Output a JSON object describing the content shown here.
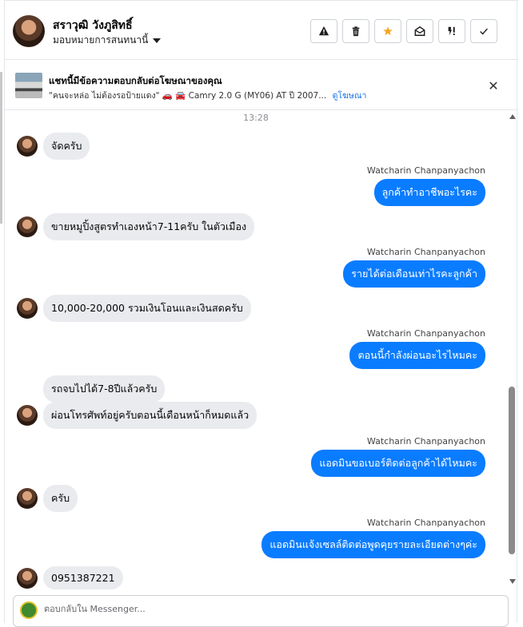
{
  "header": {
    "contact_name": "สราวุฒิ วังภูสิทธิ์",
    "assign_label": "มอบหมายการสนทนานี้",
    "actions": [
      {
        "name": "mark-spam-button",
        "icon": "warning-icon"
      },
      {
        "name": "delete-button",
        "icon": "trash-icon"
      },
      {
        "name": "star-button",
        "icon": "star-icon"
      },
      {
        "name": "mark-unread-button",
        "icon": "envelope-open-icon"
      },
      {
        "name": "follow-up-button",
        "icon": "priority-icon"
      },
      {
        "name": "mark-done-button",
        "icon": "check-icon"
      }
    ]
  },
  "ad": {
    "title": "แชทนี้มีข้อความตอบกลับต่อโฆษณาของคุณ",
    "subtitle": "\"คนจะหล่อ ไม่ต้องรอป้ายแดง\" 🚗 🚘 Camry 2.0 G (MY06) AT ปี 2007...",
    "link": "ดูโฆษณา"
  },
  "conversation": {
    "timestamp": "13:28",
    "messages": [
      {
        "dir": "in",
        "text": "จัดครับ"
      },
      {
        "dir": "out",
        "sender": "Watcharin Chanpanyachon",
        "text": "ลูกค้าทำอาชีพอะไรคะ"
      },
      {
        "dir": "in",
        "text": "ขายหมูปิ้งสูตรทำเองหน้า7-11ครับ ในตัวเมือง"
      },
      {
        "dir": "out",
        "sender": "Watcharin Chanpanyachon",
        "text": "รายได้ต่อเดือนเท่าไรคะลูกค้า"
      },
      {
        "dir": "in",
        "text": "10,000-20,000 รวมเงินโอนและเงินสดครับ"
      },
      {
        "dir": "out",
        "sender": "Watcharin Chanpanyachon",
        "text": "ตอนนี้กำลังผ่อนอะไรไหมคะ"
      },
      {
        "dir": "in",
        "text": "รถจบไปได้7-8ปีแล้วครับ"
      },
      {
        "dir": "in",
        "text": "ผ่อนโทรศัพท์อยู่ครับตอนนี้เดือนหน้าก็หมดแล้ว"
      },
      {
        "dir": "out",
        "sender": "Watcharin Chanpanyachon",
        "text": "แอดมินขอเบอร์ติดต่อลูกค้าได้ไหมคะ"
      },
      {
        "dir": "in",
        "text": "ครับ"
      },
      {
        "dir": "out",
        "sender": "Watcharin Chanpanyachon",
        "text": "แอดมินแจ้งเซลล์ติดต่อพูดคุยรายละเอียดต่างๆค่ะ"
      },
      {
        "dir": "in",
        "text": "0951387221"
      }
    ]
  },
  "composer": {
    "placeholder": "ตอบกลับใน Messenger..."
  },
  "colors": {
    "outgoing_bubble": "#0a7cff",
    "incoming_bubble": "#e9ebee",
    "link": "#1b74e4",
    "star": "#f5a623"
  }
}
